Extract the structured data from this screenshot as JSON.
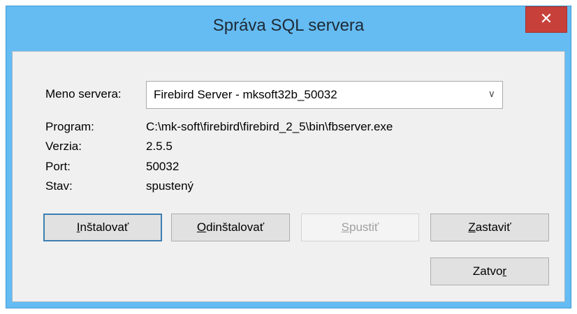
{
  "window": {
    "title": "Správa SQL servera",
    "close_label": "✕"
  },
  "fields": {
    "server_name_label": "Meno servera:",
    "server_name_value": "Firebird Server - mksoft32b_50032",
    "program_label": "Program:",
    "program_value": "C:\\mk-soft\\firebird\\firebird_2_5\\bin\\fbserver.exe",
    "version_label": "Verzia:",
    "version_value": "2.5.5",
    "port_label": "Port:",
    "port_value": "50032",
    "state_label": "Stav:",
    "state_value": "spustený"
  },
  "buttons": {
    "install": {
      "first": "I",
      "rest": "nštalovať"
    },
    "uninstall": {
      "first": "O",
      "rest": "dinštalovať"
    },
    "start": {
      "first": "S",
      "rest": "pustiť"
    },
    "stop": {
      "first": "Z",
      "rest": "astaviť"
    },
    "close": {
      "before": "Zatvo",
      "ul": "r"
    }
  },
  "icons": {
    "dropdown": "chevron-down-icon",
    "close": "close-icon"
  },
  "colors": {
    "titlebar": "#65bcf3",
    "close_button": "#c7403a",
    "client": "#f0f0f0",
    "default_button_border": "#3c7fb1"
  }
}
